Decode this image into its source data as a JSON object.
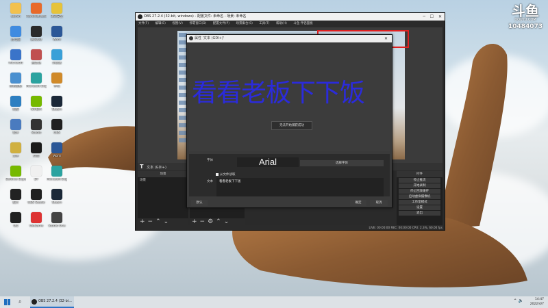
{
  "desktop": {
    "icons": [
      {
        "label": "admin",
        "color": "#f2c14e"
      },
      {
        "label": "Administrator",
        "color": "#e86a2a"
      },
      {
        "label": "360安全",
        "color": "#e6c33a"
      },
      {
        "label": "此电脑",
        "color": "#3f8be0"
      },
      {
        "label": "腾讯QQ",
        "color": "#2a2a2a"
      },
      {
        "label": "Word",
        "color": "#2b5797"
      },
      {
        "label": "Microsoft",
        "color": "#3a74c9"
      },
      {
        "label": "回收站",
        "color": "#c05050"
      },
      {
        "label": "浏览器",
        "color": "#3aa0d8"
      },
      {
        "label": "控制面板",
        "color": "#4a90d0"
      },
      {
        "label": "Microsoft Edge",
        "color": "#2ba3a0"
      },
      {
        "label": "手机",
        "color": "#d08a2a"
      },
      {
        "label": "网络",
        "color": "#2d7fc1"
      },
      {
        "label": "NVIDIA",
        "color": "#76b900"
      },
      {
        "label": "Steam",
        "color": "#1b2838"
      },
      {
        "label": "软件",
        "color": "#4a7bbf"
      },
      {
        "label": "Studio",
        "color": "#333333"
      },
      {
        "label": "OBS",
        "color": "#202020"
      },
      {
        "label": "文件",
        "color": "#d0b040"
      },
      {
        "label": "抖音",
        "color": "#1a1a1a"
      },
      {
        "label": "Word",
        "color": "#2b5797"
      },
      {
        "label": "Geforce Experience",
        "color": "#76b900"
      },
      {
        "label": "DY",
        "color": "#f0f0f0"
      },
      {
        "label": "Microsoft Edge",
        "color": "#2ba3a0"
      },
      {
        "label": "照片",
        "color": "#222222"
      },
      {
        "label": "OBS Studio",
        "color": "#202020"
      },
      {
        "label": "Steam",
        "color": "#1b2838"
      },
      {
        "label": "QQ",
        "color": "#222222"
      },
      {
        "label": "WeGame",
        "color": "#d33"
      },
      {
        "label": "Studio One",
        "color": "#444"
      }
    ]
  },
  "watermark": {
    "logo": "斗鱼",
    "url": "DOUYU.COM",
    "room": "10484073"
  },
  "obs": {
    "title": "OBS 27.2.4 (32-bit, windows) - 配置文件: 未命名 - 场景: 未命名",
    "menu": [
      "文件(F)",
      "编辑(E)",
      "视图(V)",
      "停靠窗口(D)",
      "配置文件(P)",
      "场景集合(S)",
      "工具(T)",
      "帮助(H)",
      "斗鱼 伴侣面板"
    ],
    "source_bar": {
      "icon": "T",
      "label": "文本 (GDI+)"
    },
    "docks": {
      "scenes_header": "场景",
      "scene_item": "场景",
      "controls_header": "控件",
      "controls": [
        "停止推流",
        "开始录制",
        "停止回放缓存",
        "启动虚拟摄像机",
        "工作室模式",
        "设置",
        "退出"
      ]
    },
    "status": "LIVE: 00:00:00   REC: 00:00:00   CPU: 2.3%, 60.00 fps"
  },
  "props": {
    "title": "属性 '文本 (GDI+)'",
    "preview_text": "看看老板下下饭",
    "capture_fail": "无法开始捕获成功",
    "font_label": "字体",
    "font_value": "Arial",
    "font_button": "选择字体",
    "from_file_label": "从文件读取",
    "text_label": "文本",
    "text_value": "看看老板下下饭",
    "defaults_button": "默认",
    "ok_button": "确定",
    "cancel_button": "取消",
    "text_color": "#2b2bdb"
  },
  "taskbar": {
    "app_label": "OBS 27.2.4 (32-bi...",
    "time": "14:47",
    "date": "2022/4/7"
  }
}
